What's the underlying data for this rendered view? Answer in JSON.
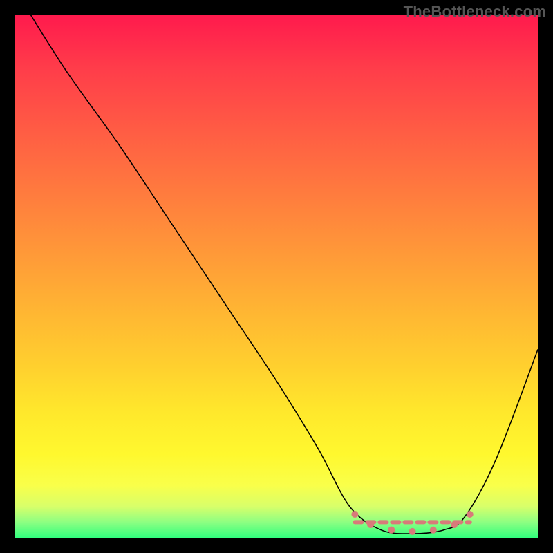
{
  "watermark": "TheBottleneck.com",
  "chart_data": {
    "type": "line",
    "title": "",
    "xlabel": "",
    "ylabel": "",
    "xlim": [
      0,
      100
    ],
    "ylim": [
      0,
      100
    ],
    "grid": false,
    "curve": [
      {
        "x": 3,
        "y": 100
      },
      {
        "x": 10,
        "y": 89
      },
      {
        "x": 20,
        "y": 75
      },
      {
        "x": 30,
        "y": 60
      },
      {
        "x": 40,
        "y": 45
      },
      {
        "x": 50,
        "y": 30
      },
      {
        "x": 58,
        "y": 17
      },
      {
        "x": 64,
        "y": 6
      },
      {
        "x": 70,
        "y": 1.5
      },
      {
        "x": 76,
        "y": 0.8
      },
      {
        "x": 82,
        "y": 1.5
      },
      {
        "x": 86,
        "y": 4
      },
      {
        "x": 92,
        "y": 15
      },
      {
        "x": 100,
        "y": 36
      }
    ],
    "highlight_band": {
      "x_start": 65,
      "x_end": 87,
      "y": 3
    },
    "highlight_markers": [
      {
        "x": 65,
        "y": 4.5
      },
      {
        "x": 68,
        "y": 2.5
      },
      {
        "x": 72,
        "y": 1.5
      },
      {
        "x": 76,
        "y": 1.2
      },
      {
        "x": 80,
        "y": 1.5
      },
      {
        "x": 84,
        "y": 2.5
      },
      {
        "x": 87,
        "y": 4.5
      }
    ],
    "highlight_color": "#d87a7a"
  }
}
